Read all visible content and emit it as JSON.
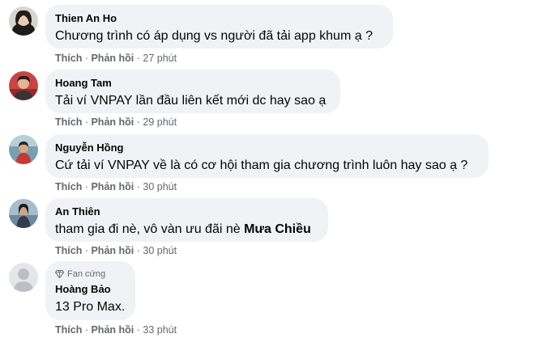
{
  "comments": [
    {
      "name": "Thien An Ho",
      "text": "Chương trình có áp dụng vs người đã tải app khum ạ ?",
      "like": "Thích",
      "reply": "Phản hồi",
      "time": "27 phút"
    },
    {
      "name": "Hoang Tam",
      "text": "Tải ví VNPAY lần đầu liên kết mới dc hay sao ạ",
      "like": "Thích",
      "reply": "Phản hồi",
      "time": "29 phút"
    },
    {
      "name": "Nguyễn Hồng",
      "text": "Cứ tải ví VNPAY về là có cơ hội tham gia chương trình luôn hay sao ạ ?",
      "like": "Thích",
      "reply": "Phản hồi",
      "time": "30 phút"
    },
    {
      "name": "An Thiên",
      "text_before": "tham gia đi nè, vô vàn ưu đãi nè ",
      "mention": "Mưa Chiều",
      "like": "Thích",
      "reply": "Phản hồi",
      "time": "30 phút"
    },
    {
      "badge": "Fan cứng",
      "name": "Hoàng Bảo",
      "text": "13 Pro Max.",
      "like": "Thích",
      "reply": "Phản hồi",
      "time": "33 phút"
    }
  ],
  "separator": "·",
  "colors": {
    "bubble": "#f0f2f5",
    "meta": "#65676b",
    "text": "#050505"
  }
}
